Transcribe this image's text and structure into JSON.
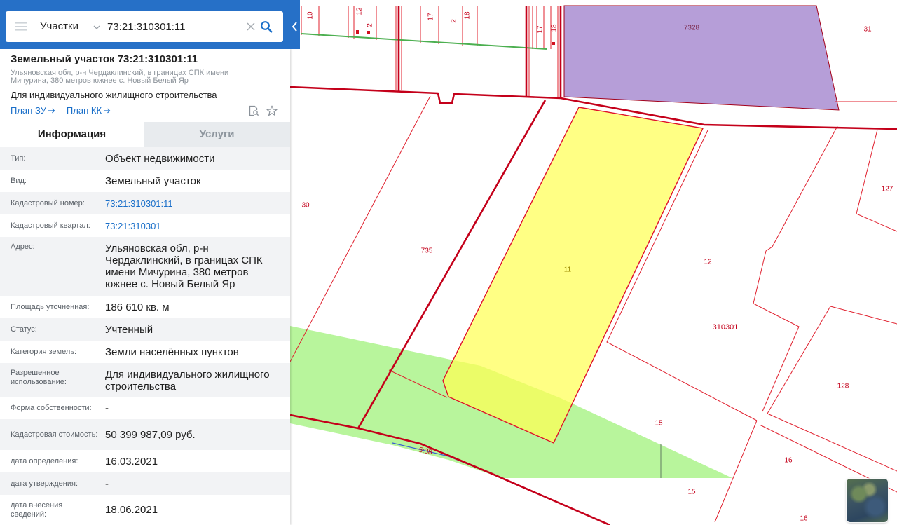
{
  "header": {
    "layer_select": "Участки",
    "search_value": "73:21:310301:11"
  },
  "card": {
    "title": "Земельный участок 73:21:310301:11",
    "address": "Ульяновская обл, р-н Чердаклинский, в границах СПК имени Мичурина, 380 метров южнее с. Новый Белый Яр",
    "purpose": "Для индивидуального жилищного строительства",
    "links": [
      {
        "label": "План ЗУ"
      },
      {
        "label": "План КК"
      }
    ]
  },
  "tabs": [
    {
      "label": "Информация",
      "active": true
    },
    {
      "label": "Услуги",
      "active": false
    }
  ],
  "info": {
    "rows": [
      {
        "label": "Тип:",
        "value": "Объект недвижимости"
      },
      {
        "label": "Вид:",
        "value": "Земельный участок"
      },
      {
        "label": "Кадастровый номер:",
        "value": "73:21:310301:11",
        "link": true
      },
      {
        "label": "Кадастровый квартал:",
        "value": "73:21:310301",
        "link": true
      },
      {
        "label": "Адрес:",
        "value": "Ульяновская обл, р-н Чердаклинский, в границах СПК имени Мичурина, 380 метров южнее с. Новый Белый Яр"
      },
      {
        "label": "Площадь уточненная:",
        "value": "186 610 кв. м"
      },
      {
        "label": "Статус:",
        "value": "Учтенный"
      },
      {
        "label": "Категория земель:",
        "value": "Земли населённых пунктов"
      },
      {
        "label": "Разрешенное использование:",
        "value": "Для индивидуального жилищного строительства"
      },
      {
        "label": "Форма собственности:",
        "value": "-"
      },
      {
        "label": "Кадастровая стоимость:",
        "value": "50 399 987,09 руб."
      },
      {
        "label": "дата определения:",
        "value": "16.03.2021"
      },
      {
        "label": "дата утверждения:",
        "value": "-"
      },
      {
        "label": "дата внесения сведений:",
        "value": "18.06.2021"
      }
    ]
  },
  "map": {
    "labels": {
      "p10": "10",
      "p12_top": "12",
      "p2_a": "2",
      "p17_a": "17",
      "p2_b": "2",
      "p18_a": "18",
      "p17_b": "17",
      "p18_b": "18",
      "p7328": "7328",
      "p31": "31",
      "p30": "30",
      "p735": "735",
      "p11": "11",
      "p12": "12",
      "q310301": "310301",
      "p127": "127",
      "p128": "128",
      "p15_a": "15",
      "p15_b": "15",
      "p16_a": "16",
      "p16_b": "16",
      "line_538": "5:38"
    }
  },
  "icons": {
    "menu": "hamburger-icon",
    "layer_dropdown": "chevron-down-icon",
    "clear": "close-icon",
    "search": "search-icon",
    "collapse": "chevron-left-icon",
    "link_arrow": "arrow-right-icon",
    "zoom_to": "document-search-icon",
    "favorite": "star-icon",
    "basemap": "satellite-layer-thumbnail"
  },
  "colors": {
    "header_blue": "#2670c7",
    "link": "#1a6fc9",
    "parcel_outline": "#c4001a",
    "selected_fill": "#ffff55",
    "green_zone": "#b8f59c",
    "purple_parcel": "#b69ed8"
  }
}
